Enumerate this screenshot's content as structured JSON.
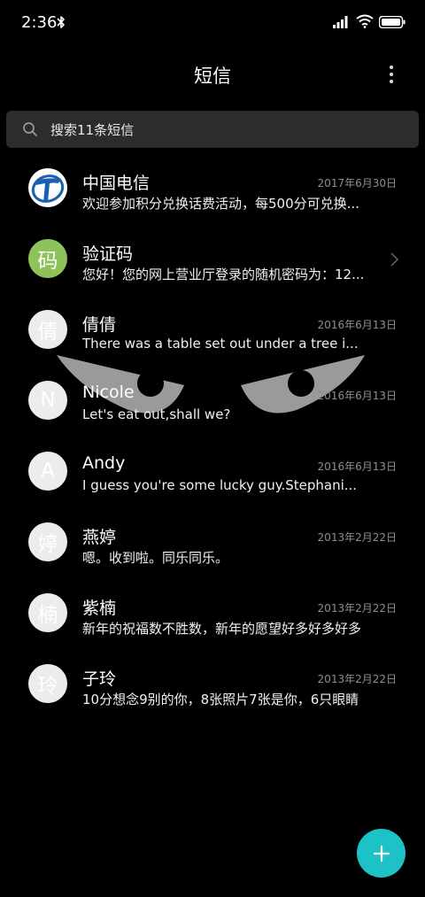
{
  "status_bar": {
    "time": "2:36",
    "icons": [
      "bluetooth-icon",
      "signal-icon",
      "wifi-icon",
      "battery-icon"
    ]
  },
  "app_bar": {
    "title": "短信",
    "menu_icon": "more-vertical-icon"
  },
  "search": {
    "placeholder": "搜索11条短信",
    "icon": "search-icon"
  },
  "conversations": [
    {
      "avatar": "",
      "avatar_icon": "china-telecom-logo",
      "name": "中国电信",
      "date": "2017年6月30日",
      "preview": "欢迎参加积分兑换话费活动，每500分可兑换话费"
    },
    {
      "avatar": "码",
      "name": "验证码",
      "date": "",
      "preview": "您好！您的网上营业厅登录的随机密码为：123456",
      "trailing_icon": "chevron-right-icon"
    },
    {
      "avatar": "倩",
      "name": "倩倩",
      "date": "2016年6月13日",
      "preview": "There was a table set out under a tree in front of the house"
    },
    {
      "avatar": "N",
      "name": "Nicole",
      "date": "2016年6月13日",
      "preview": "Let's eat out,shall we?"
    },
    {
      "avatar": "A",
      "name": "Andy",
      "date": "2016年6月13日",
      "preview": "I guess you're some lucky guy.Stephanie said"
    },
    {
      "avatar": "婷",
      "name": "燕婷",
      "date": "2013年2月22日",
      "preview": "嗯。收到啦。同乐同乐。"
    },
    {
      "avatar": "楠",
      "name": "紫楠",
      "date": "2013年2月22日",
      "preview": "新年的祝福数不胜数，新年的愿望好多好多好多"
    },
    {
      "avatar": "玲",
      "name": "子玲",
      "date": "2013年2月22日",
      "preview": "10分想念9别的你，8张照片7张是你，6只眼睛"
    }
  ],
  "fab": {
    "icon": "plus-icon"
  },
  "colors": {
    "background": "#000000",
    "search_bg": "#2c2c2e",
    "fab": "#1cc2c6",
    "verify_avatar": "#8ec35b",
    "date_text": "#8d8d8d"
  }
}
